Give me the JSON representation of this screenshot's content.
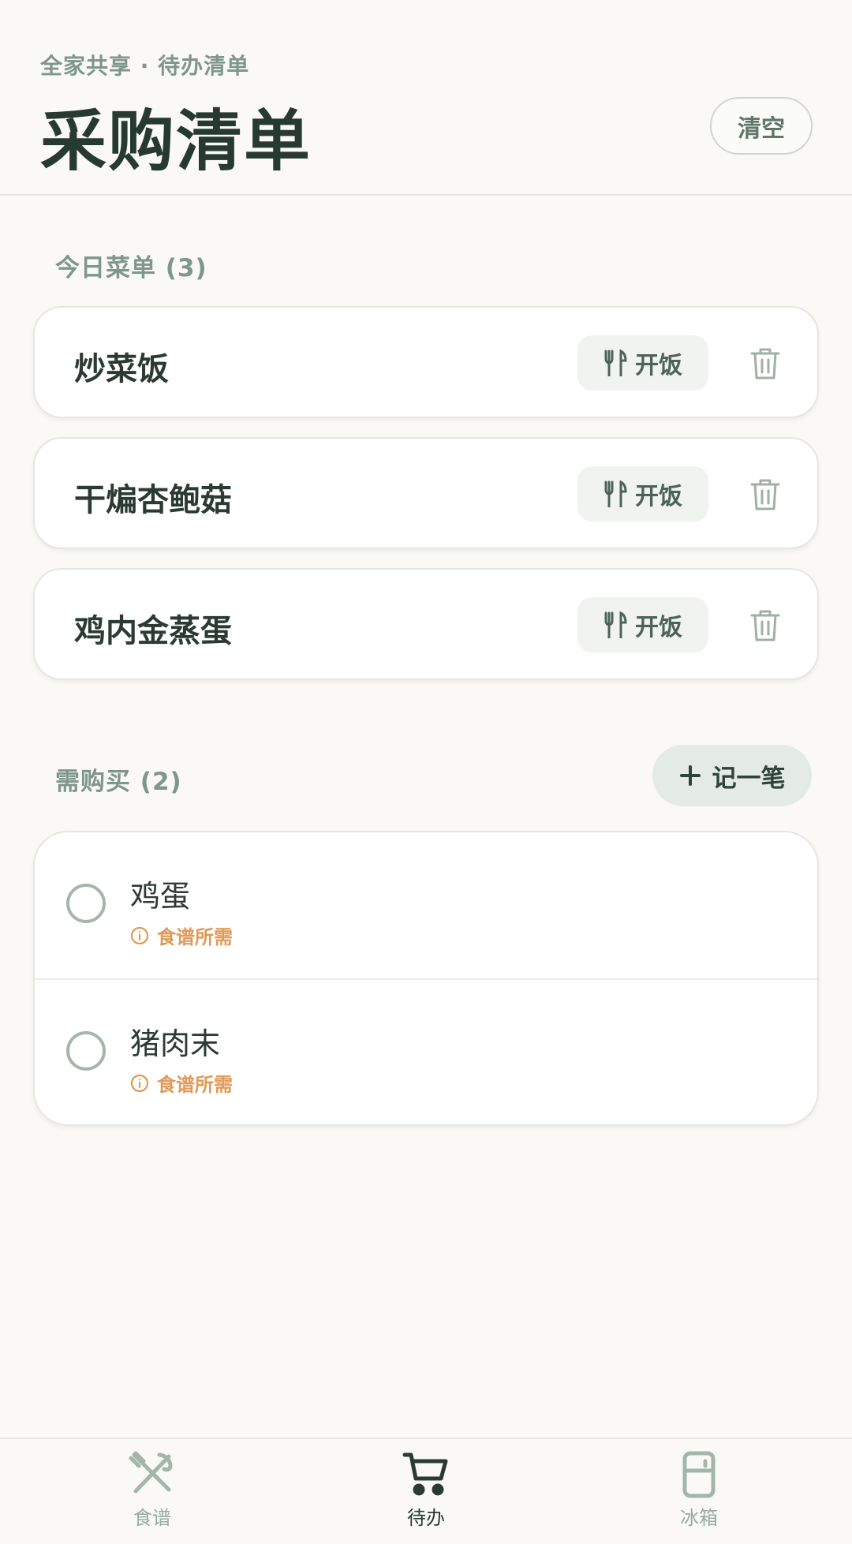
{
  "header": {
    "subtitle": "全家共享 · 待办清单",
    "title": "采购清单",
    "clear_label": "清空"
  },
  "today_menu": {
    "label": "今日菜单 (3)",
    "items": [
      {
        "name": "炒菜饭",
        "action": "开饭"
      },
      {
        "name": "干煸杏鲍菇",
        "action": "开饭"
      },
      {
        "name": "鸡内金蒸蛋",
        "action": "开饭"
      }
    ]
  },
  "to_buy": {
    "label": "需购买 (2)",
    "add_label": "记一笔",
    "items": [
      {
        "name": "鸡蛋",
        "tag": "食谱所需",
        "checked": false
      },
      {
        "name": "猪肉末",
        "tag": "食谱所需",
        "checked": false
      }
    ]
  },
  "nav": {
    "items": [
      {
        "label": "食谱",
        "icon": "utensils-crossed-icon",
        "active": false
      },
      {
        "label": "待办",
        "icon": "cart-icon",
        "active": true
      },
      {
        "label": "冰箱",
        "icon": "fridge-icon",
        "active": false
      }
    ]
  },
  "colors": {
    "background": "#faf9f6",
    "accent": "#2b3a33",
    "muted": "#7f968a",
    "tag": "#e09a58"
  }
}
